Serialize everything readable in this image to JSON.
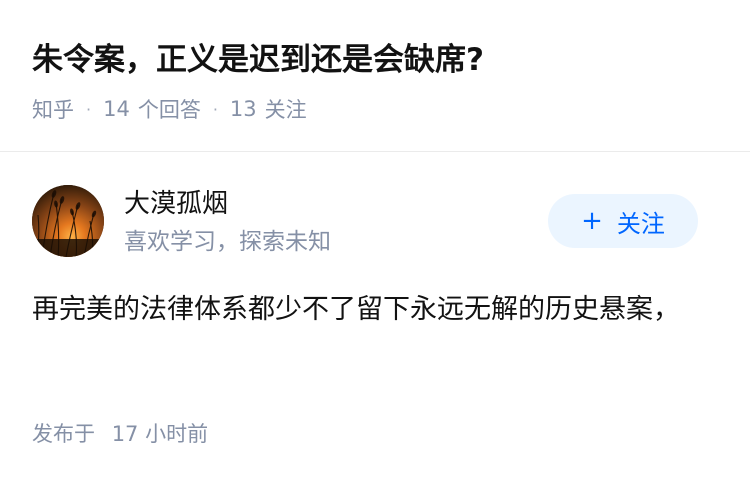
{
  "question": {
    "title": "朱令案，正义是迟到还是会缺席?",
    "source": "知乎",
    "answer_count": "14",
    "answer_label": "个回答",
    "follow_count": "13",
    "follow_label": "关注"
  },
  "answer": {
    "author_name": "大漠孤烟",
    "author_bio": "喜欢学习，探索未知",
    "follow_button": {
      "icon": "+",
      "label": "关注"
    },
    "content": "再完美的法律体系都少不了留下永远无解的历史悬案，",
    "published_label": "发布于",
    "published_value": "17 小时前"
  },
  "colors": {
    "title": "#121212",
    "meta": "#8590a6",
    "accent": "#0066ff",
    "button_bg": "#ebf5ff",
    "divider": "#ebebeb"
  },
  "icons": {
    "avatar": "sunset-reeds-avatar"
  }
}
